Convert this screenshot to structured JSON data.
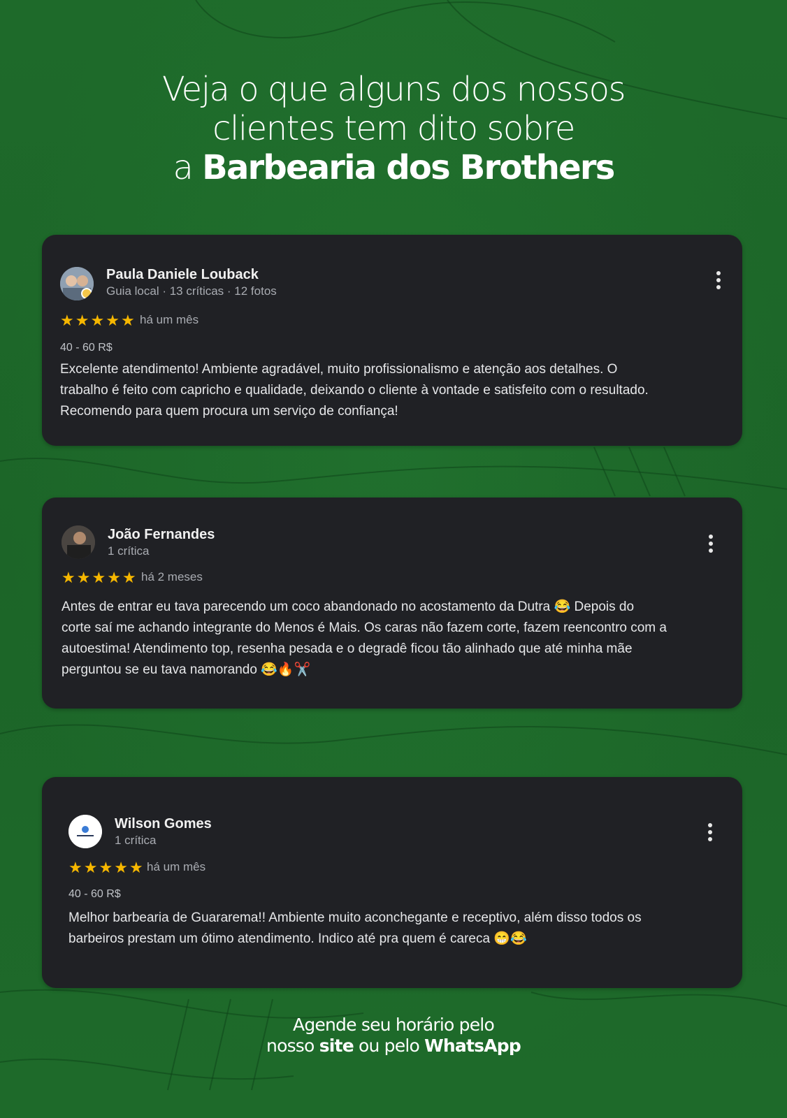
{
  "headline": {
    "line1": "Veja o que alguns dos nossos",
    "line2": "clientes tem dito sobre",
    "line3_prefix": "a ",
    "line3_bold": "Barbearia dos Brothers"
  },
  "reviews": [
    {
      "name": "Paula Daniele Louback",
      "meta": "Guia local · 13 críticas · 12 fotos",
      "stars": "★★★★★",
      "when": "há um mês",
      "price": "40 - 60 R$",
      "text_lines": [
        "Excelente atendimento! Ambiente agradável, muito profissionalismo e atenção aos detalhes. O",
        "trabalho é feito com capricho e qualidade, deixando o cliente à vontade e satisfeito com o resultado.",
        "Recomendo para quem procura um serviço de confiança!"
      ]
    },
    {
      "name": "João Fernandes",
      "meta": "1 crítica",
      "stars": "★★★★★",
      "when": "há 2 meses",
      "text_lines": [
        "Antes de entrar eu tava parecendo um coco abandonado no acostamento da Dutra 😂 Depois do",
        "corte saí me achando integrante do Menos é Mais. Os caras não fazem corte, fazem reencontro com a",
        "autoestima! Atendimento top, resenha pesada e o degradê ficou tão alinhado que até minha mãe",
        "perguntou se eu tava namorando 😂🔥✂️"
      ]
    },
    {
      "name": "Wilson Gomes",
      "meta": "1 crítica",
      "stars": "★★★★★",
      "when": "há um mês",
      "price": "40 - 60 R$",
      "text_lines": [
        "Melhor barbearia de Guararema!! Ambiente muito aconchegante e receptivo, além disso todos os",
        "barbeiros prestam um ótimo atendimento. Indico até pra quem é careca 😁😂"
      ]
    }
  ],
  "footer": {
    "line1": "Agende  seu horário pelo",
    "line2_a": "nosso ",
    "line2_site": "site",
    "line2_b": " ou pelo ",
    "line2_whatsapp": "WhatsApp"
  },
  "icons": {
    "menu": "more-vert-icon",
    "star": "star-icon",
    "avatar": "user-avatar"
  },
  "colors": {
    "background": "#1f6b2b",
    "card": "#202125",
    "star": "#f6b700"
  }
}
